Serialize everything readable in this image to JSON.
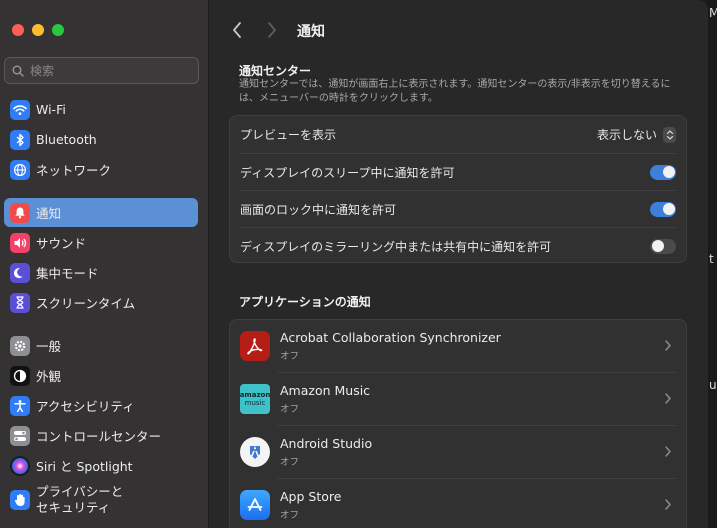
{
  "search": {
    "placeholder": "検索"
  },
  "sidebar": {
    "items": [
      {
        "label": "Wi-Fi",
        "icon": "wifi-icon",
        "color": "#2f7cf6"
      },
      {
        "label": "Bluetooth",
        "icon": "bluetooth-icon",
        "color": "#2f7cf6"
      },
      {
        "label": "ネットワーク",
        "icon": "globe-icon",
        "color": "#2f7cf6"
      },
      {
        "label": "通知",
        "icon": "bell-icon",
        "color": "#f14b4b",
        "active": true
      },
      {
        "label": "サウンド",
        "icon": "speaker-icon",
        "color": "#f0426a"
      },
      {
        "label": "集中モード",
        "icon": "moon-icon",
        "color": "#5b4fd8"
      },
      {
        "label": "スクリーンタイム",
        "icon": "hourglass-icon",
        "color": "#5b4fd8"
      },
      {
        "label": "一般",
        "icon": "gear-icon",
        "color": "#8e8e93"
      },
      {
        "label": "外観",
        "icon": "appearance-icon",
        "color": "#1c1c1e"
      },
      {
        "label": "アクセシビリティ",
        "icon": "accessibility-icon",
        "color": "#2f7cf6"
      },
      {
        "label": "コントロールセンター",
        "icon": "switches-icon",
        "color": "#8e8e93"
      },
      {
        "label": "Siri と Spotlight",
        "icon": "siri-icon",
        "color": "#1c1c1e"
      },
      {
        "label": "プライバシーと\nセキュリティ",
        "label1": "プライバシーと",
        "label2": "セキュリティ",
        "icon": "hand-icon",
        "color": "#2f7cf6"
      }
    ]
  },
  "header": {
    "title": "通知"
  },
  "notification_center": {
    "title": "通知センター",
    "description": "通知センターでは、通知が画面右上に表示されます。通知センターの表示/非表示を切り替えるには、メニューバーの時計をクリックします。"
  },
  "settings": {
    "preview_label": "プレビューを表示",
    "preview_value": "表示しない",
    "sleep_label": "ディスプレイのスリープ中に通知を許可",
    "sleep_on": true,
    "lock_label": "画面のロック中に通知を許可",
    "lock_on": true,
    "mirror_label": "ディスプレイのミラーリング中または共有中に通知を許可",
    "mirror_on": false
  },
  "apps": {
    "title": "アプリケーションの通知",
    "items": [
      {
        "name": "Acrobat Collaboration Synchronizer",
        "status": "オフ",
        "icon": "acrobat-icon"
      },
      {
        "name": "Amazon Music",
        "status": "オフ",
        "icon": "amazon-music-icon",
        "icon_text1": "amazon",
        "icon_text2": "music"
      },
      {
        "name": "Android Studio",
        "status": "オフ",
        "icon": "android-studio-icon"
      },
      {
        "name": "App Store",
        "status": "オフ",
        "icon": "app-store-icon"
      }
    ]
  },
  "background_window": {
    "fragment1": "M",
    "fragment2": "t",
    "fragment3": "u"
  }
}
